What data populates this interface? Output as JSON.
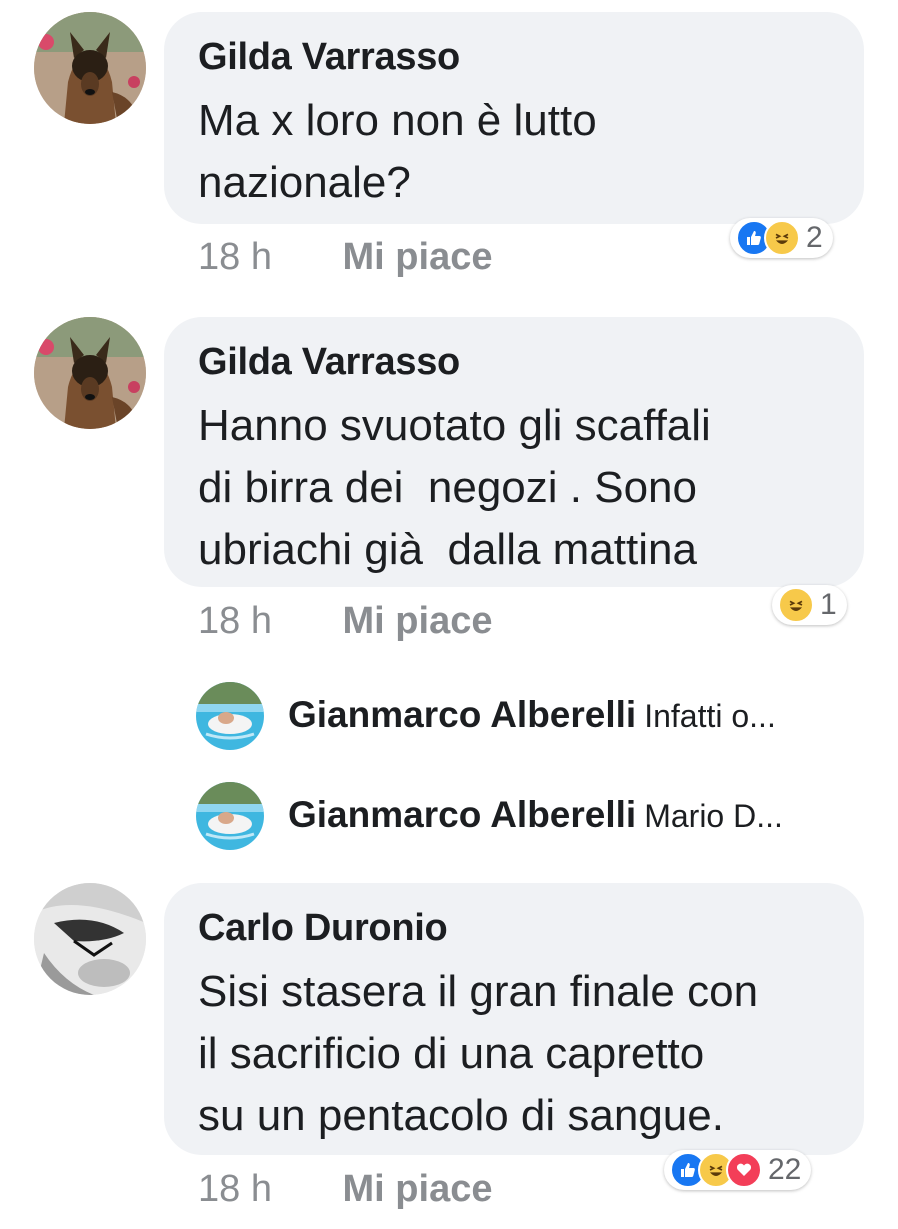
{
  "comments": [
    {
      "author": "Gilda Varrasso",
      "text": "Ma x loro non è lutto\nnazionale?",
      "time": "18 h",
      "like_label": "Mi piace",
      "reactions": [
        "like-icon",
        "haha-icon"
      ],
      "reaction_count": "2"
    },
    {
      "author": "Gilda Varrasso",
      "text": "Hanno svuotato gli scaffali\ndi birra dei  negozi . Sono\nubriachi già  dalla mattina",
      "time": "18 h",
      "like_label": "Mi piace",
      "reactions": [
        "haha-icon"
      ],
      "reaction_count": "1"
    },
    {
      "author": "Carlo Duronio",
      "text": "Sisi stasera il gran finale con\nil sacrificio di una capretto\nsu un pentacolo di sangue.",
      "time": "18 h",
      "like_label": "Mi piace",
      "reactions": [
        "like-icon",
        "haha-icon",
        "love-icon"
      ],
      "reaction_count": "22"
    }
  ],
  "replies": [
    {
      "author": "Gianmarco Alberelli",
      "snippet": "Infatti o..."
    },
    {
      "author": "Gianmarco Alberelli",
      "snippet": "Mario D..."
    }
  ],
  "colors": {
    "bubble": "#f0f2f5",
    "meta_text": "#8a8d91",
    "like_blue": "#1877f2",
    "haha_yellow": "#f7c94a",
    "love_red": "#f33e58"
  }
}
